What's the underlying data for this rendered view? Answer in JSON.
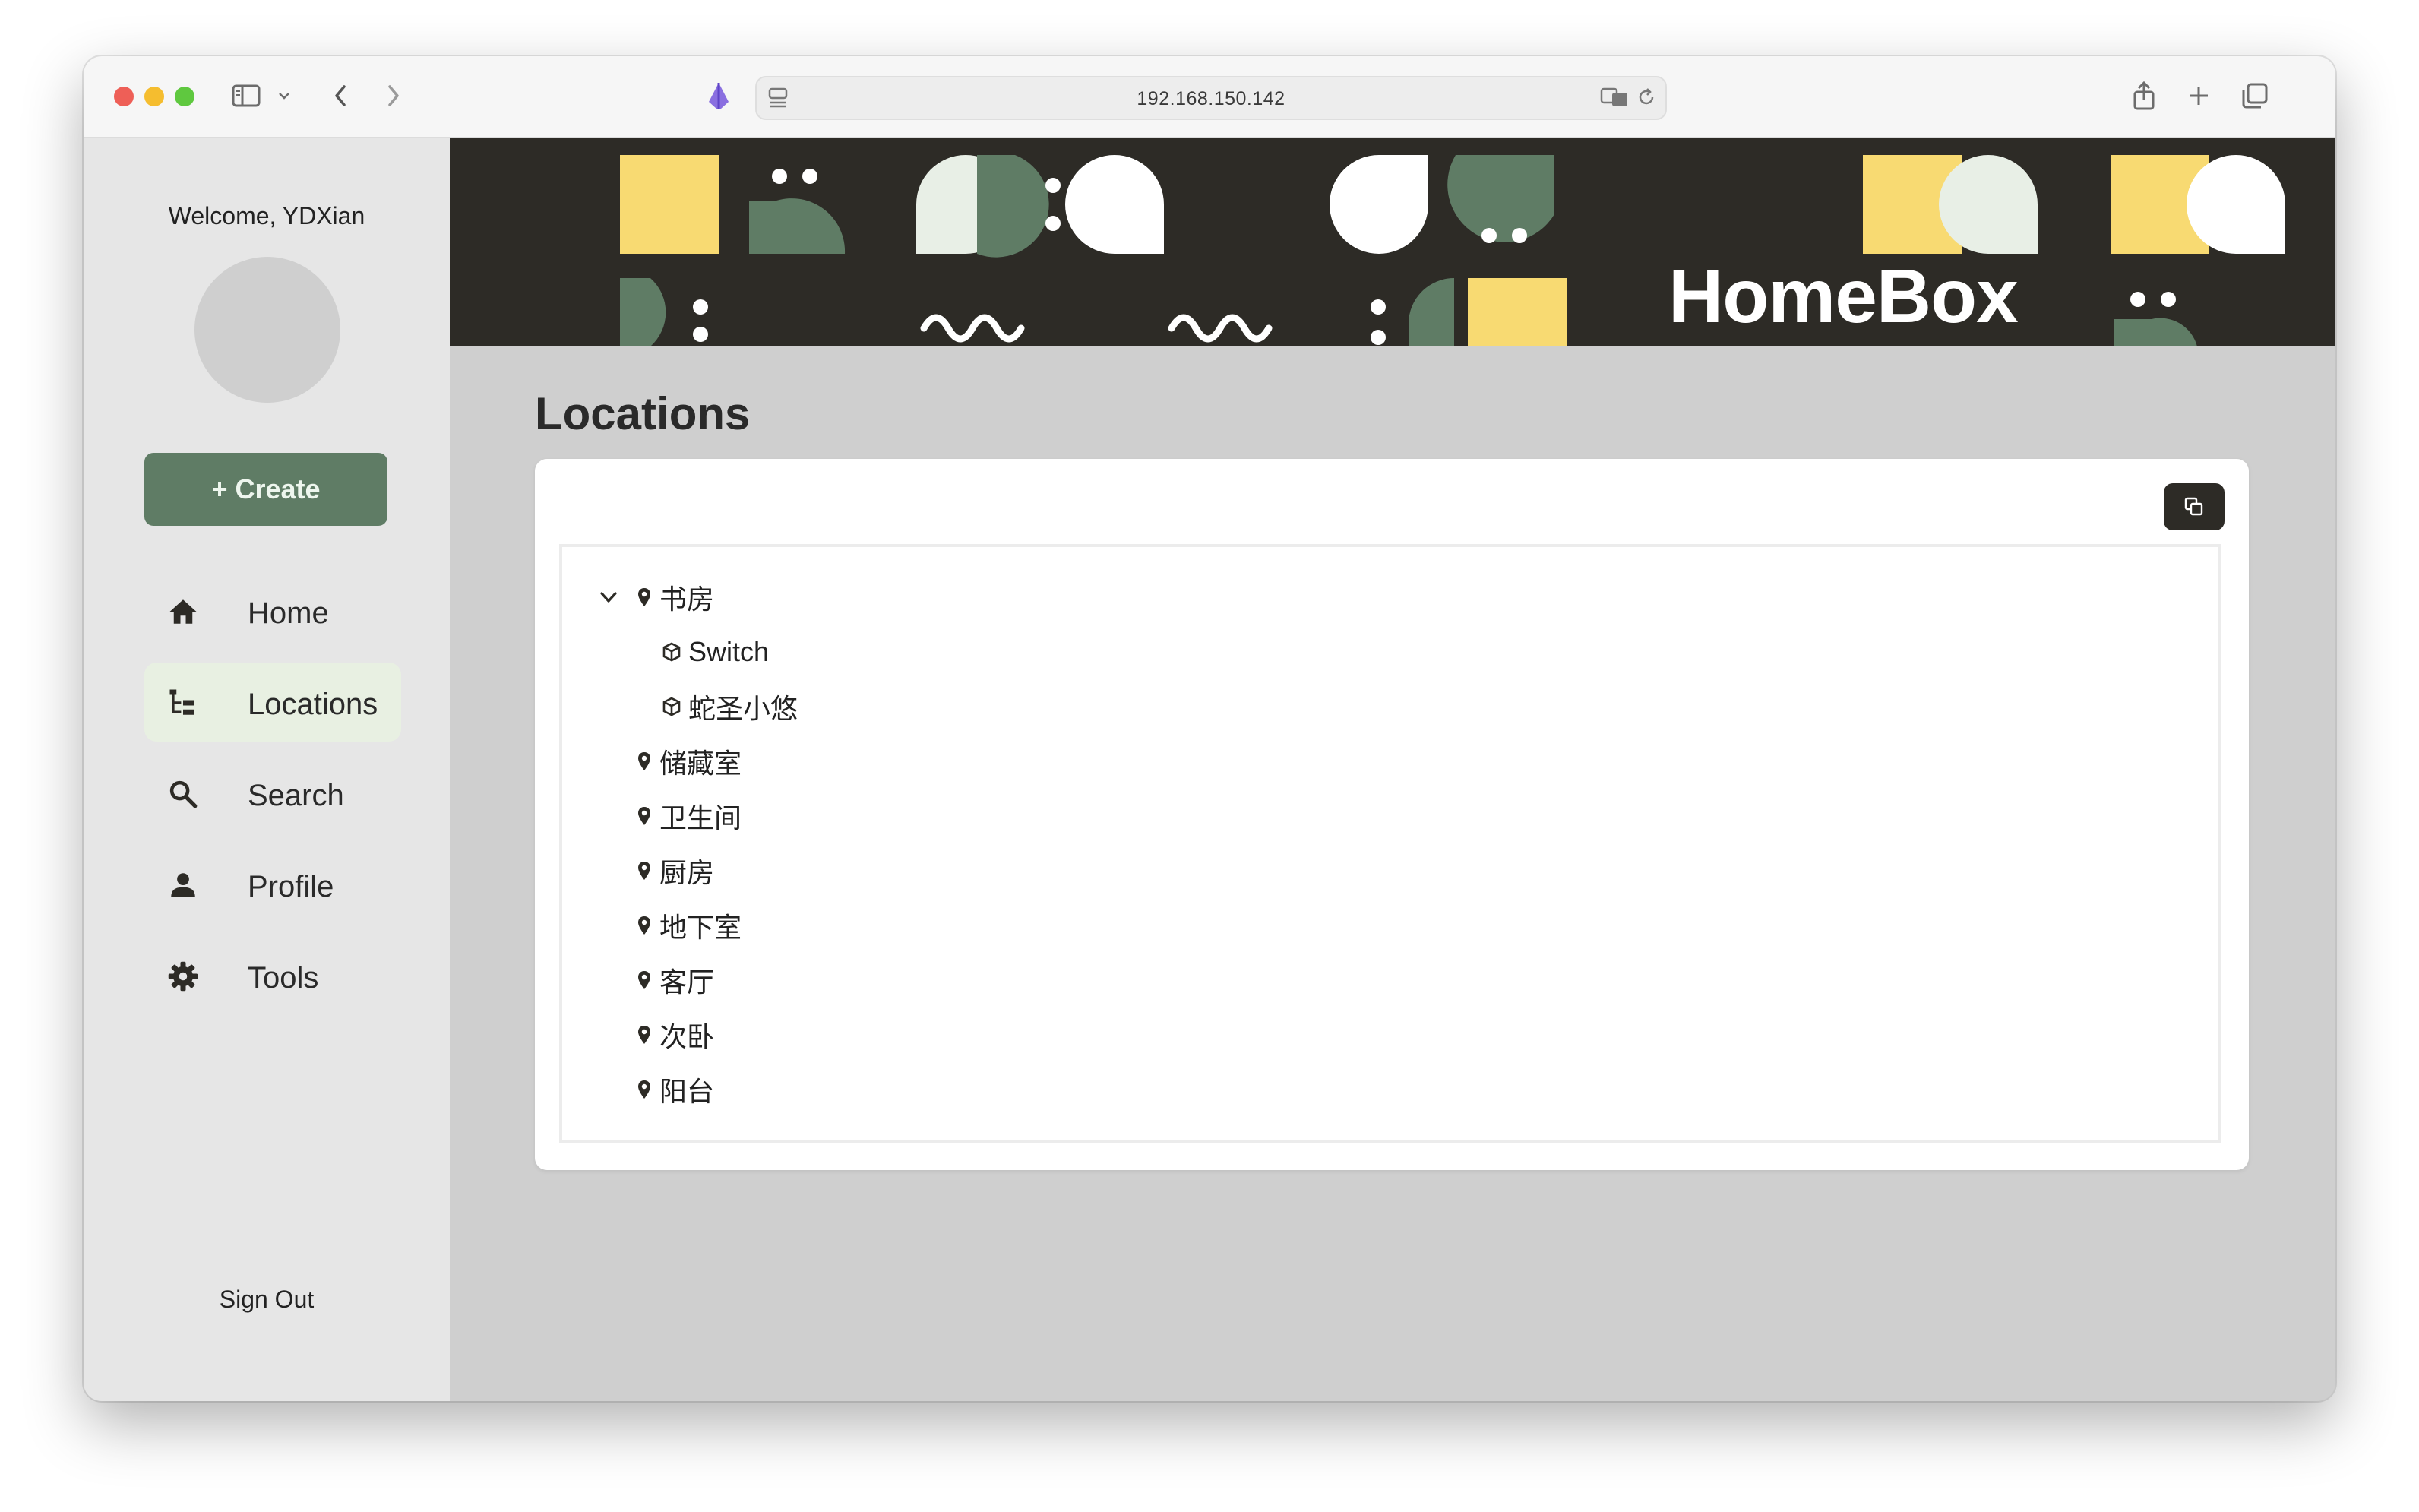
{
  "browser": {
    "url": "192.168.150.142"
  },
  "sidebar": {
    "welcome": "Welcome, YDXian",
    "create_label": "+ Create",
    "items": [
      {
        "label": "Home",
        "icon": "home-icon",
        "active": false
      },
      {
        "label": "Locations",
        "icon": "locations-tree-icon",
        "active": true
      },
      {
        "label": "Search",
        "icon": "search-icon",
        "active": false
      },
      {
        "label": "Profile",
        "icon": "person-icon",
        "active": false
      },
      {
        "label": "Tools",
        "icon": "gear-icon",
        "active": false
      }
    ],
    "sign_out": "Sign Out"
  },
  "banner": {
    "brand": "HomeBox"
  },
  "main": {
    "title": "Locations",
    "tree": [
      {
        "label": "书房",
        "kind": "location",
        "expanded": true,
        "children": [
          {
            "label": "Switch",
            "kind": "item"
          },
          {
            "label": "蛇圣小悠",
            "kind": "item"
          }
        ]
      },
      {
        "label": "储藏室",
        "kind": "location"
      },
      {
        "label": "卫生间",
        "kind": "location"
      },
      {
        "label": "厨房",
        "kind": "location"
      },
      {
        "label": "地下室",
        "kind": "location"
      },
      {
        "label": "客厅",
        "kind": "location"
      },
      {
        "label": "次卧",
        "kind": "location"
      },
      {
        "label": "阳台",
        "kind": "location"
      }
    ]
  },
  "colors": {
    "accent_green": "#5f7c65",
    "banner_dark": "#2d2b26",
    "banner_yellow": "#f8da72",
    "banner_cream": "#e8efe6",
    "active_nav": "#e8f0e2"
  }
}
